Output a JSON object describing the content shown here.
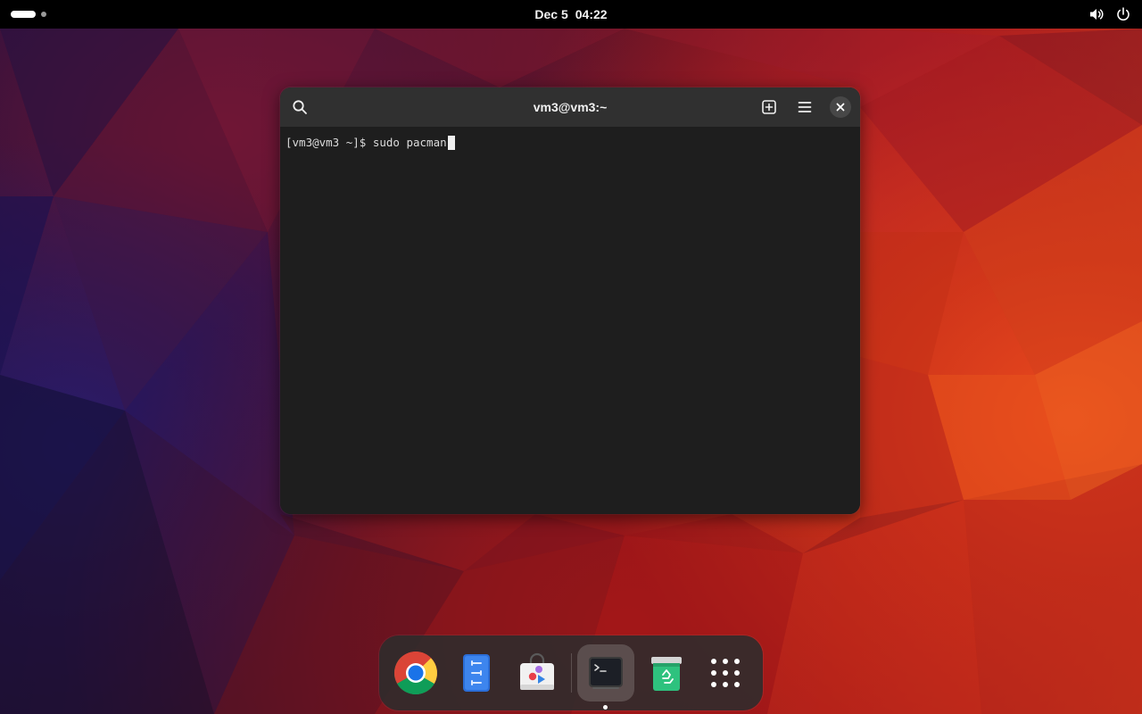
{
  "topbar": {
    "date": "Dec 5",
    "time": "04:22",
    "icons": [
      "workspace-indicator",
      "speaker-icon",
      "power-icon"
    ]
  },
  "terminal": {
    "title": "vm3@vm3:~",
    "prompt": "[vm3@vm3 ~]$ ",
    "command": "sudo pacman",
    "header_icons": [
      "search-icon",
      "new-tab-icon",
      "hamburger-menu-icon",
      "close-icon"
    ]
  },
  "dock": {
    "apps": [
      {
        "name": "Google Chrome",
        "icon": "chrome-icon"
      },
      {
        "name": "Text Editor",
        "icon": "text-editor-icon"
      },
      {
        "name": "Software",
        "icon": "software-store-icon"
      },
      {
        "name": "Terminal",
        "icon": "terminal-icon",
        "running": true
      },
      {
        "name": "Trash",
        "icon": "trash-icon"
      },
      {
        "name": "Show Apps",
        "icon": "app-grid-icon"
      }
    ]
  },
  "colors": {
    "topbar_bg": "#000000",
    "terminal_bg": "#1e1e1e",
    "terminal_header_bg": "#303030",
    "dock_bg": "#2c2c2c"
  }
}
